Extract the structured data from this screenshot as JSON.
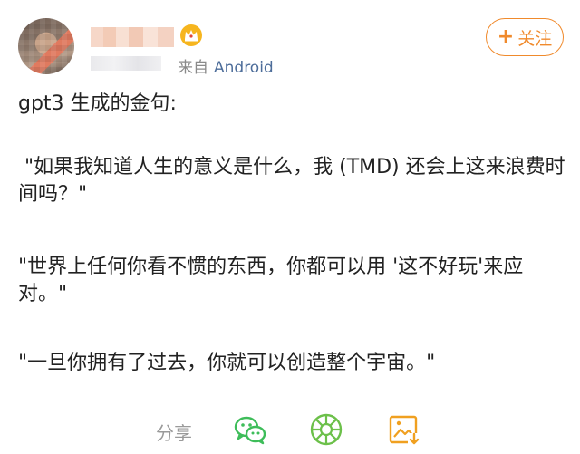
{
  "header": {
    "source_prefix": "来自",
    "source_device": "Android",
    "follow_label": "关注",
    "follow_plus": "+",
    "accent_color": "#f08a2c",
    "link_color": "#4d6d9a",
    "badge_icon": "crown-icon"
  },
  "post": {
    "intro": "gpt3 生成的金句:",
    "quote1": " \"如果我知道人生的意义是什么，我 (TMD) 还会上这来浪费时间吗？\"",
    "quote2": "\"世界上任何你看不惯的东西，你都可以用 '这不好玩'来应对。\"",
    "quote3": "\"一旦你拥有了过去，你就可以创造整个宇宙。\""
  },
  "footer": {
    "share_label": "分享",
    "share_targets": [
      "wechat-icon",
      "moments-icon",
      "save-image-icon"
    ],
    "wechat_color": "#3ebd5a",
    "moments_color": "#6cc04a",
    "save_color": "#f0a020"
  }
}
